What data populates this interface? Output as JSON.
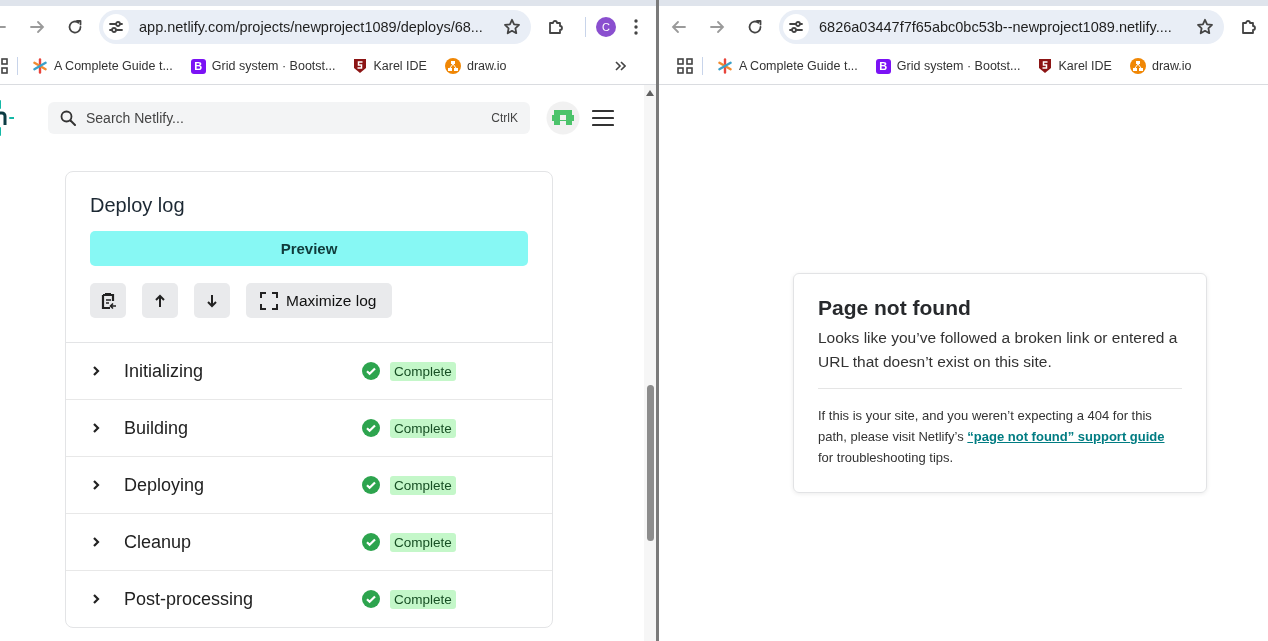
{
  "left_window": {
    "address_bar": {
      "url": "app.netlify.com/projects/newproject1089/deploys/68..."
    },
    "profile": {
      "initial": "C"
    },
    "bookmarks": [
      {
        "kind": "asterisk",
        "label": "A Complete Guide t..."
      },
      {
        "kind": "letter",
        "icon_text": "B",
        "label": "Grid system · Bootst..."
      },
      {
        "kind": "shield",
        "label": "Karel IDE"
      },
      {
        "kind": "drawio",
        "label": "draw.io"
      }
    ],
    "header": {
      "search": {
        "placeholder": "Search Netlify...",
        "shortcut": "CtrlK"
      }
    },
    "deploy_log": {
      "title": "Deploy log",
      "preview_button": "Preview",
      "maximize_button": "Maximize log",
      "steps": [
        {
          "name": "Initializing",
          "status": "Complete",
          "expanded": false
        },
        {
          "name": "Building",
          "status": "Complete",
          "expanded": false
        },
        {
          "name": "Deploying",
          "status": "Complete",
          "expanded": false
        },
        {
          "name": "Cleanup",
          "status": "Complete",
          "expanded": false
        },
        {
          "name": "Post-processing",
          "status": "Complete",
          "expanded": false
        }
      ]
    }
  },
  "right_window": {
    "address_bar": {
      "url": "6826a03447f7f65abc0bc53b--newproject1089.netlify...."
    },
    "bookmarks": [
      {
        "kind": "asterisk",
        "label": "A Complete Guide t..."
      },
      {
        "kind": "letter",
        "icon_text": "B",
        "label": "Grid system · Bootst..."
      },
      {
        "kind": "shield",
        "label": "Karel IDE"
      },
      {
        "kind": "drawio",
        "label": "draw.io"
      }
    ],
    "not_found": {
      "title": "Page not found",
      "message": "Looks like you’ve followed a broken link or entered a URL that doesn’t exist on this site.",
      "help_before": "If this is your site, and you weren’t expecting a 404 for this path, please visit Netlify’s ",
      "help_link": "“page not found” support guide",
      "help_after": " for troubleshooting tips."
    }
  }
}
